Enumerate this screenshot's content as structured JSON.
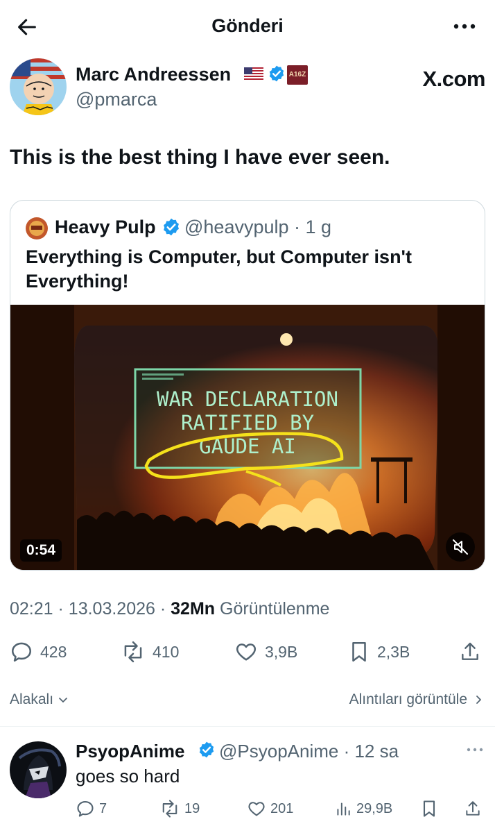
{
  "header": {
    "title": "Gönderi"
  },
  "author": {
    "name": "Marc Andreessen",
    "handle": "@pmarca",
    "flag_emoji": "🇺🇸",
    "badge_text": "A16Z",
    "source_label": "X.com"
  },
  "tweet": {
    "text": "This is the best thing I have ever seen."
  },
  "quote": {
    "name": "Heavy Pulp",
    "handle": "@heavypulp",
    "time": "· 1 g",
    "text": "Everything is Computer, but Computer isn't Everything!",
    "media": {
      "screen_lines": [
        "WAR DECLARATION",
        "RATIFIED BY",
        "GAUDE AI"
      ],
      "duration": "0:54"
    }
  },
  "meta": {
    "time": "02:21",
    "date": "13.03.2026",
    "views_count": "32Mn",
    "views_label": "Görüntülenme"
  },
  "actions": {
    "replies": "428",
    "reposts": "410",
    "likes": "3,9B",
    "bookmarks": "2,3B"
  },
  "sort": {
    "left_label": "Alakalı",
    "right_label": "Alıntıları görüntüle"
  },
  "reply": {
    "name": "PsyopAnime",
    "handle": "@PsyopAnime",
    "time": "· 12 sa",
    "text": "goes so hard",
    "replies": "7",
    "reposts": "19",
    "likes": "201",
    "views": "29,9B"
  },
  "colors": {
    "verified": "#1d9bf0",
    "secondary_text": "#536471",
    "primary_text": "#0f1419",
    "border": "#cfd9de",
    "terminal_green": "#7dd6a8",
    "highlight_yellow": "#f5e11b"
  }
}
